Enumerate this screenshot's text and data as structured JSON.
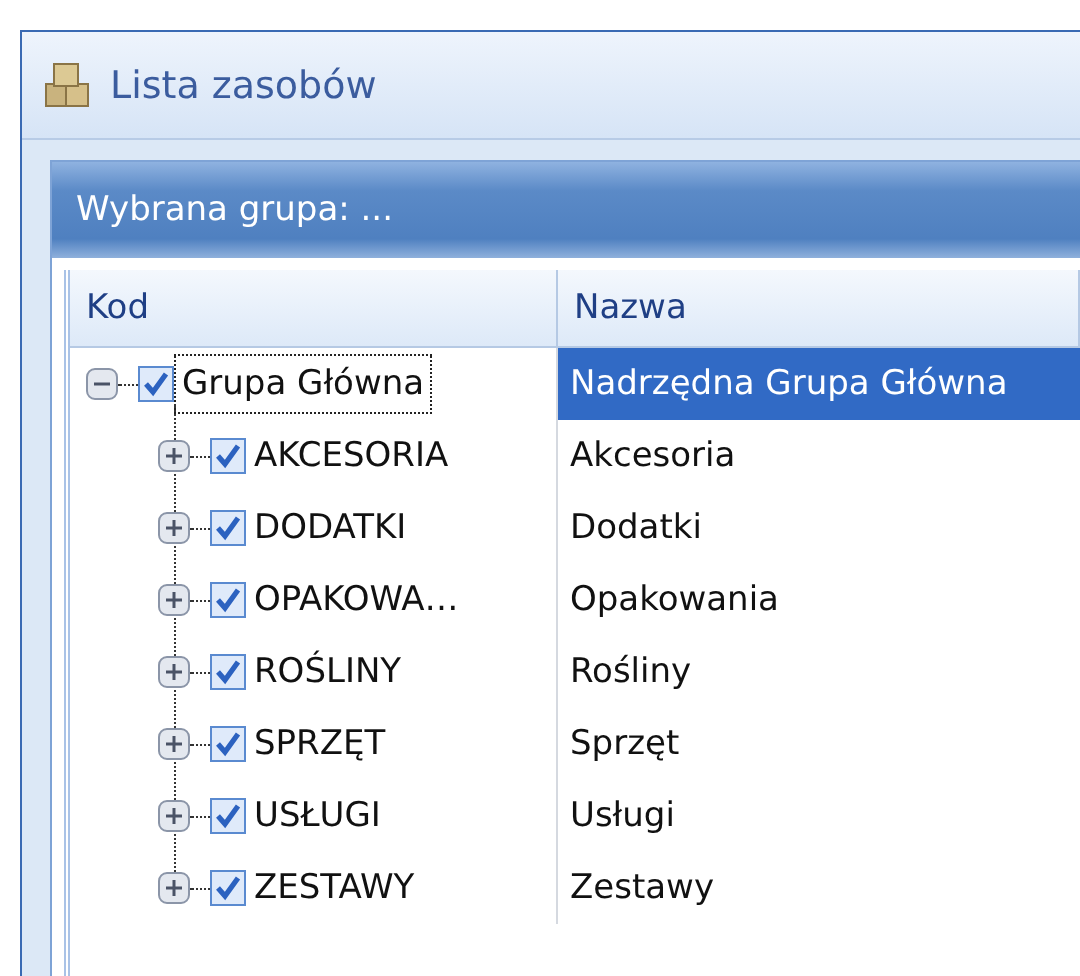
{
  "window": {
    "title": "Lista zasobów"
  },
  "group_panel": {
    "title": "Wybrana grupa: ..."
  },
  "table": {
    "columns": [
      "Kod",
      "Nazwa"
    ],
    "rows": [
      {
        "code": "Grupa Główna",
        "name": "Nadrzędna Grupa Główna",
        "checked": true,
        "expanded": true,
        "selected": true,
        "children": [
          {
            "code": "AKCESORIA",
            "name": "Akcesoria",
            "checked": true,
            "expanded": false,
            "selected": false
          },
          {
            "code": "DODATKI",
            "name": "Dodatki",
            "checked": true,
            "expanded": false,
            "selected": false
          },
          {
            "code": "OPAKOWA…",
            "name": "Opakowania",
            "checked": true,
            "expanded": false,
            "selected": false
          },
          {
            "code": "ROŚLINY",
            "name": "Rośliny",
            "checked": true,
            "expanded": false,
            "selected": false
          },
          {
            "code": "SPRZĘT",
            "name": "Sprzęt",
            "checked": true,
            "expanded": false,
            "selected": false
          },
          {
            "code": "USŁUGI",
            "name": "Usługi",
            "checked": true,
            "expanded": false,
            "selected": false
          },
          {
            "code": "ZESTAWY",
            "name": "Zestawy",
            "checked": true,
            "expanded": false,
            "selected": false
          }
        ]
      }
    ]
  }
}
